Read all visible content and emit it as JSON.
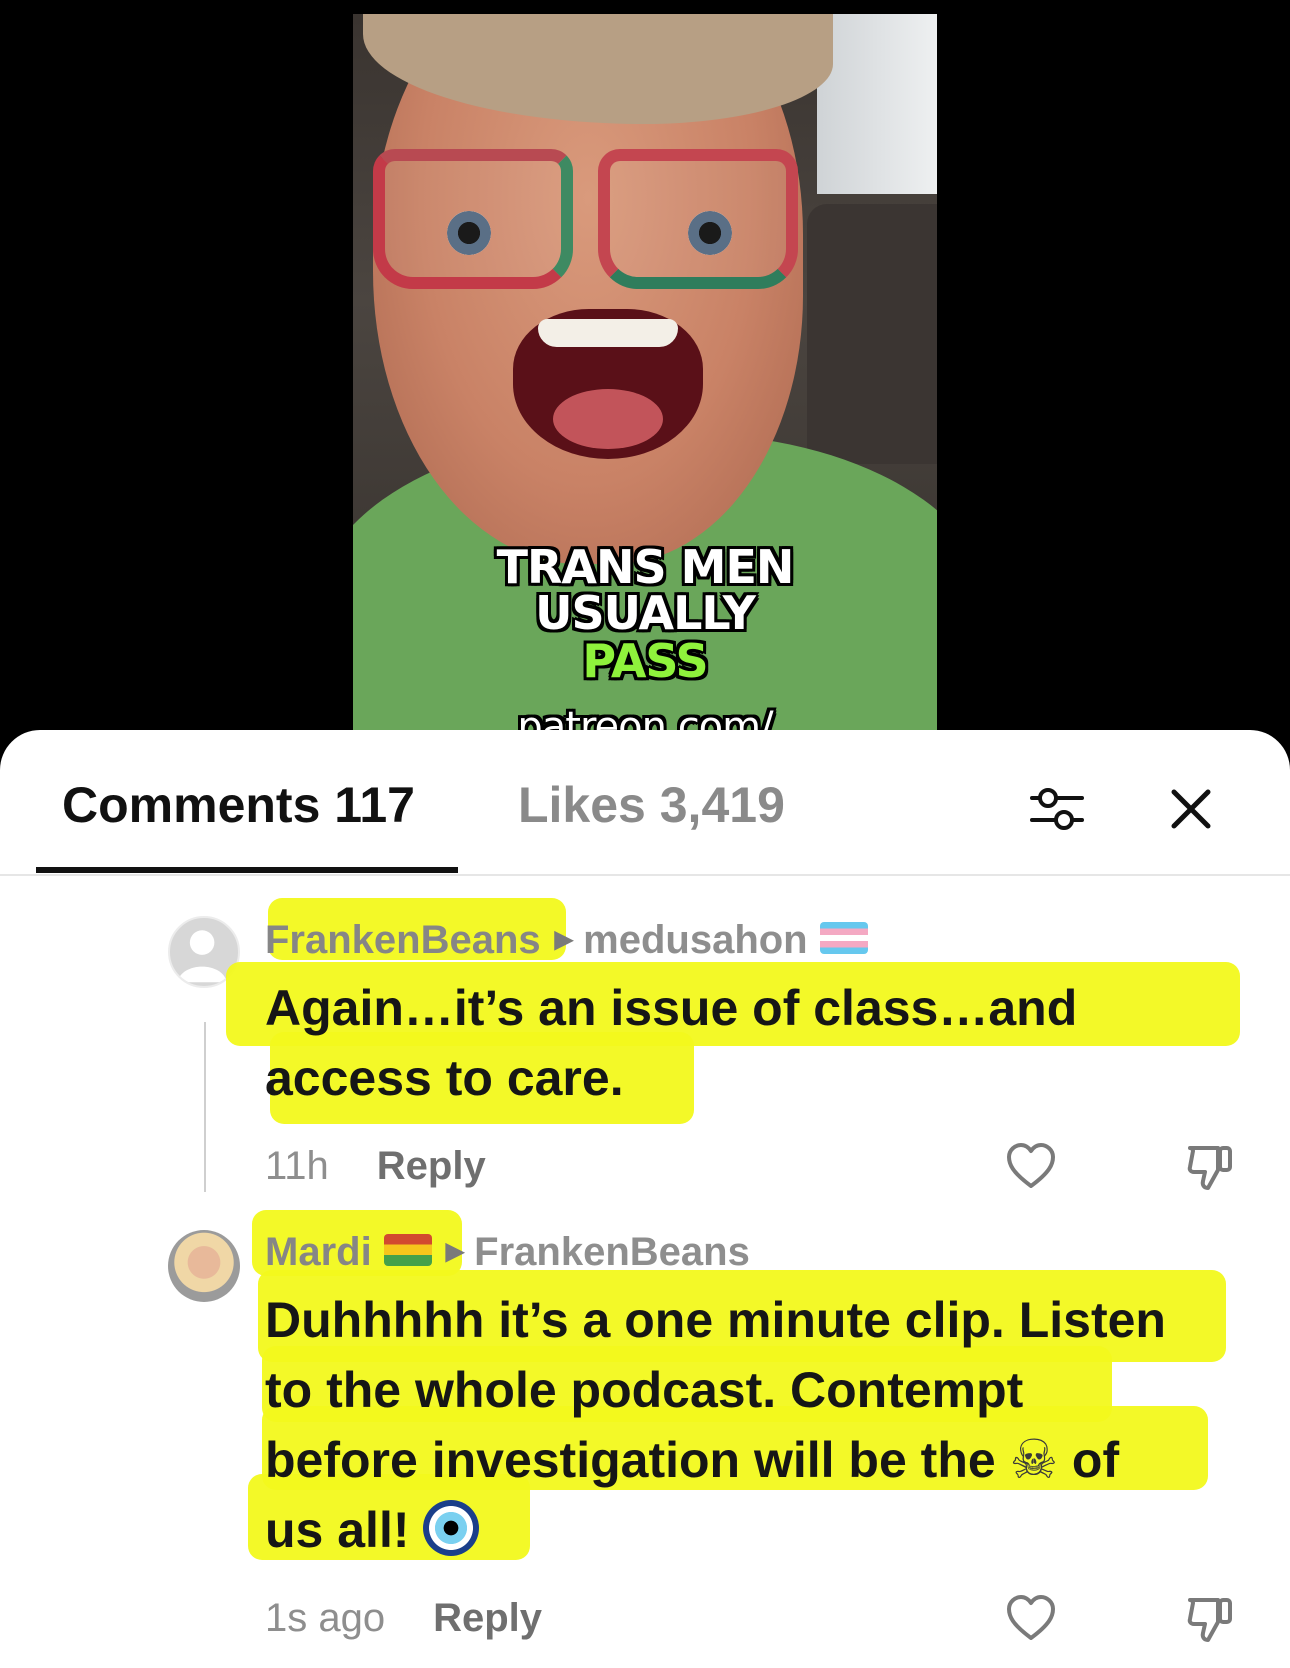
{
  "video": {
    "caption_line1": "TRANS MEN",
    "caption_line2": "USUALLY",
    "caption_line3": "PASS",
    "caption_line4": "patreon.com/"
  },
  "tabs": {
    "comments_label": "Comments 117",
    "likes_label": "Likes 3,419"
  },
  "comments": [
    {
      "author": "FrankenBeans",
      "reply_to": "medusahon",
      "text_line1": "Again…it’s an issue of class…and",
      "text_line2": "access to care.",
      "time": "11h",
      "reply_label": "Reply"
    },
    {
      "author": "Mardi",
      "reply_to": "FrankenBeans",
      "text_line1": "Duhhhhh it’s a one minute clip. Listen",
      "text_line2": "to the whole podcast. Contempt",
      "text_line3a": "before investigation will be the",
      "text_line3b": "of",
      "text_line4": "us all!",
      "time": "1s ago",
      "reply_label": "Reply"
    }
  ],
  "colors": {
    "highlight": "#f2f91c",
    "caption_accent": "#8ff23c"
  },
  "icons": [
    "filter-icon",
    "close-icon",
    "heart-icon",
    "dislike-icon",
    "skull-and-crossbones-emoji",
    "evil-eye-emoji",
    "transgender-flag-icon",
    "flag-icon"
  ]
}
